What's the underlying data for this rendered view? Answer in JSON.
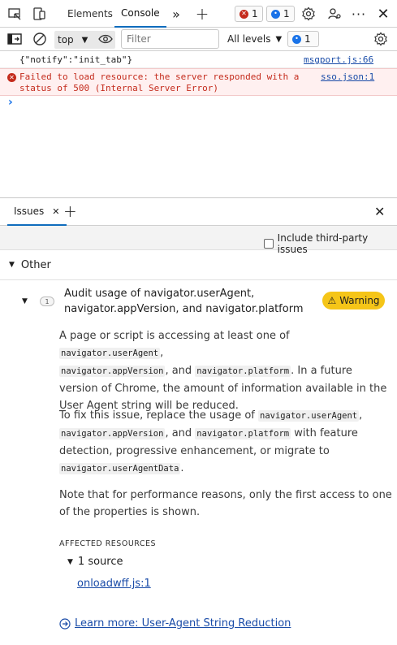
{
  "top_tabs": {
    "elements": "Elements",
    "console": "Console",
    "errors_count": "1",
    "info_count": "1"
  },
  "console_toolbar": {
    "context": "top",
    "filter_placeholder": "Filter",
    "levels": "All levels",
    "issues_count": "1"
  },
  "console_messages": [
    {
      "text": "{\"notify\":\"init_tab\"}",
      "source": "msgport.js:66",
      "level": "log"
    },
    {
      "text": "Failed to load resource: the server responded with a status of 500 (Internal Server Error)",
      "line1": "Failed to load resource: the server responded with a",
      "line2": "status of 500 (Internal Server Error)",
      "source": "sso.json:1",
      "level": "error"
    }
  ],
  "prompt_symbol": "›",
  "drawer": {
    "tab_label": "Issues",
    "include_third_party": "Include third-party issues"
  },
  "issues": {
    "section": "Other",
    "issue": {
      "count": "1",
      "title_line1": "Audit usage of navigator.userAgent,",
      "title_line2": "navigator.appVersion, and navigator.platform",
      "severity": "Warning",
      "p1": {
        "a": "A page or script is accessing at least one of ",
        "c1": "navigator.userAgent",
        "b": ",",
        "c2": "navigator.appVersion",
        "d": ", and ",
        "c3": "navigator.platform",
        "e": ". In a future version of Chrome, the amount of information available in the User Agent string will be reduced."
      },
      "p2": {
        "a": "To fix this issue, replace the usage of ",
        "c1": "navigator.userAgent",
        "b": ",",
        "c2": "navigator.appVersion",
        "d": ", and ",
        "c3": "navigator.platform",
        "e": " with feature detection, progressive enhancement, or migrate to ",
        "c4": "navigator.userAgentData",
        "f": "."
      },
      "p3": "Note that for performance reasons, only the first access to one of the properties is shown.",
      "affected_heading": "AFFECTED RESOURCES",
      "source_count": "1 source",
      "resource": "onloadwff.js:1",
      "learn_more": "Learn more: User-Agent String Reduction"
    }
  }
}
